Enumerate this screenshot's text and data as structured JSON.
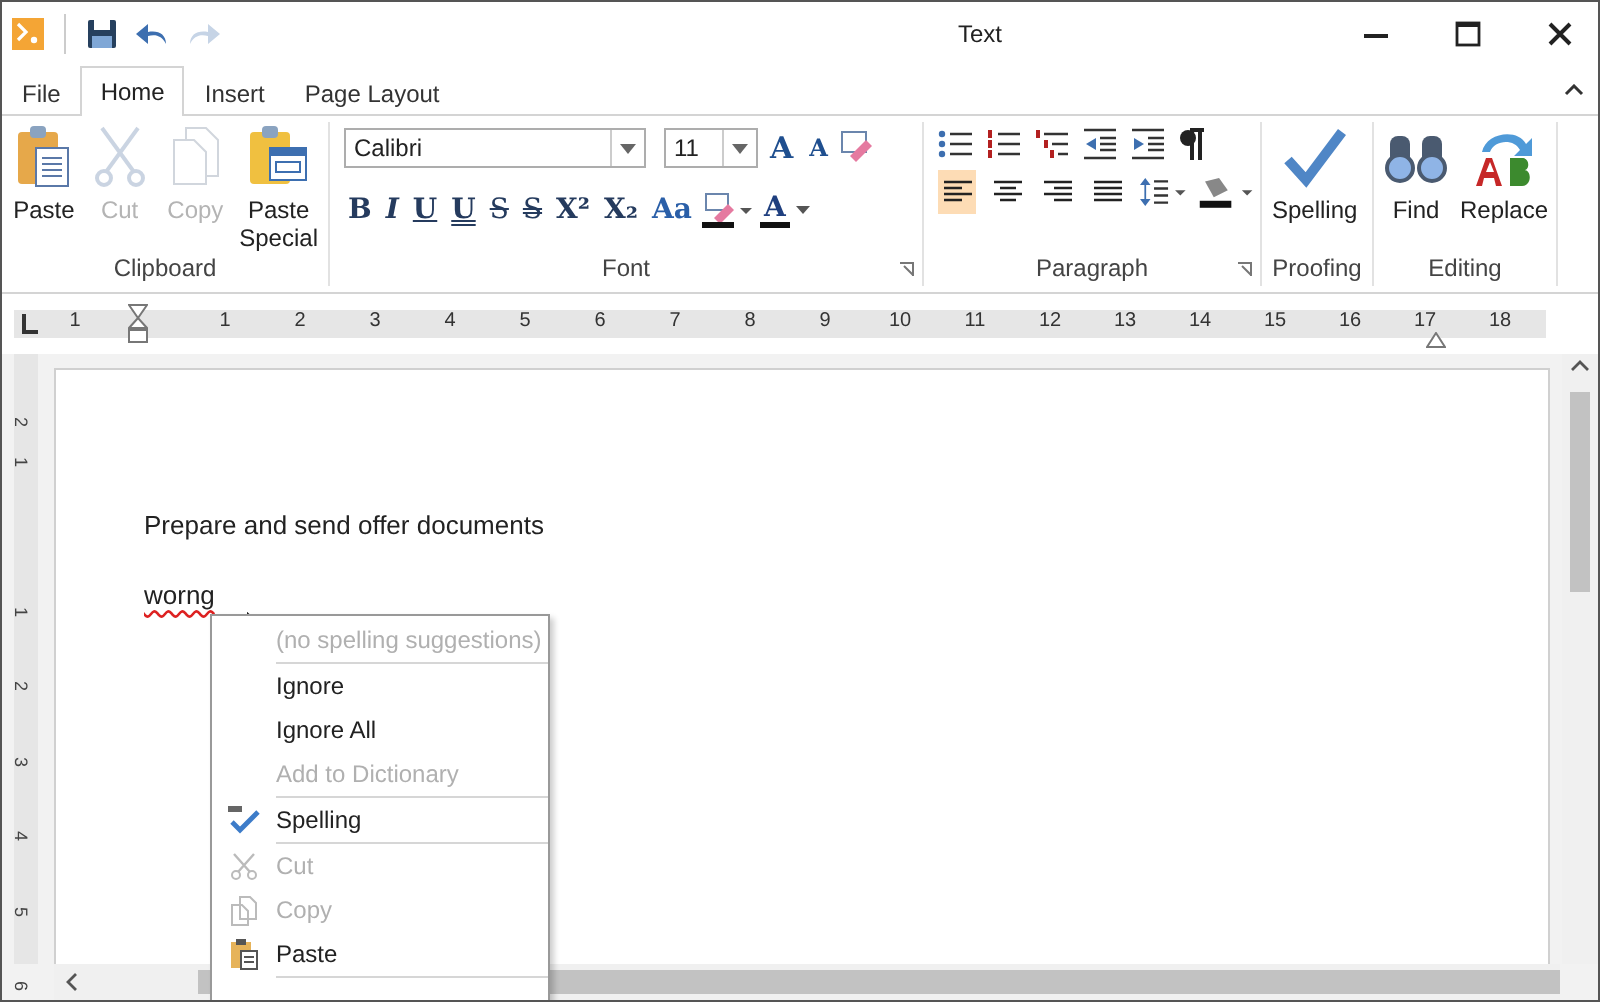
{
  "window": {
    "title": "Text"
  },
  "tabs": [
    {
      "label": "File",
      "selected": false
    },
    {
      "label": "Home",
      "selected": true
    },
    {
      "label": "Insert",
      "selected": false
    },
    {
      "label": "Page Layout",
      "selected": false
    }
  ],
  "clipboard": {
    "label": "Clipboard",
    "buttons": [
      {
        "label": "Paste",
        "disabled": false
      },
      {
        "label": "Cut",
        "disabled": true
      },
      {
        "label": "Copy",
        "disabled": true
      },
      {
        "label": "Paste Special",
        "disabled": false
      }
    ]
  },
  "font": {
    "label": "Font",
    "name": "Calibri",
    "size": "11",
    "grow": "A",
    "shrink": "A",
    "styles": [
      "B",
      "I",
      "U",
      "U",
      "S",
      "S",
      "X²",
      "X₂",
      "Aa"
    ],
    "color_letter": "A"
  },
  "paragraph": {
    "label": "Paragraph",
    "alignments": [
      {
        "selected": true
      },
      {
        "selected": false
      },
      {
        "selected": false
      },
      {
        "selected": false
      }
    ]
  },
  "proofing": {
    "label": "Proofing",
    "button": "Spelling"
  },
  "editing": {
    "label": "Editing",
    "buttons": [
      "Find",
      "Replace"
    ]
  },
  "ruler": {
    "labels": [
      "1",
      "1",
      "2",
      "3",
      "4",
      "5",
      "6",
      "7",
      "8",
      "9",
      "10",
      "11",
      "12",
      "13",
      "14",
      "15",
      "16",
      "17",
      "18"
    ]
  },
  "vertical_ruler": {
    "labels": [
      "2",
      "1",
      "1",
      "2",
      "3",
      "4",
      "5",
      "6"
    ]
  },
  "document": {
    "lines": [
      {
        "text": "Prepare and send offer documents",
        "misspelled": false
      },
      {
        "text": "worng",
        "misspelled": true
      }
    ]
  },
  "context_menu": [
    {
      "label": "(no spelling suggestions)",
      "disabled": true,
      "separator_after": true
    },
    {
      "label": "Ignore",
      "disabled": false,
      "separator_after": false
    },
    {
      "label": "Ignore All",
      "disabled": false,
      "separator_after": false
    },
    {
      "label": "Add to Dictionary",
      "disabled": true,
      "separator_after": true
    },
    {
      "label": "Spelling",
      "disabled": false,
      "separator_after": true
    },
    {
      "label": "Cut",
      "disabled": true,
      "separator_after": false
    },
    {
      "label": "Copy",
      "disabled": true,
      "separator_after": false
    },
    {
      "label": "Paste",
      "disabled": false,
      "separator_after": true
    }
  ]
}
